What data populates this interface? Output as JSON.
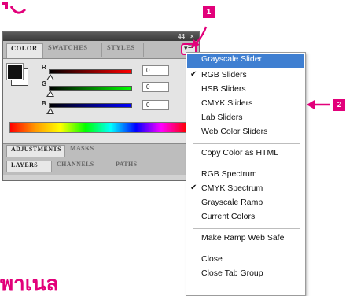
{
  "panel": {
    "tabs": [
      "COLOR",
      "SWATCHES",
      "STYLES"
    ],
    "title_controls": "44",
    "close_glyph": "×",
    "menu_icon": "panel-menu-icon",
    "channels": [
      {
        "label": "R",
        "value": "0",
        "gradient": [
          "#000000",
          "#ff0000"
        ]
      },
      {
        "label": "G",
        "value": "0",
        "gradient": [
          "#000000",
          "#00ff00"
        ]
      },
      {
        "label": "B",
        "value": "0",
        "gradient": [
          "#000000",
          "#0000ff"
        ]
      }
    ],
    "adjustments_tabs": [
      "ADJUSTMENTS",
      "MASKS"
    ],
    "layers_tabs": [
      "LAYERS",
      "CHANNELS",
      "PATHS"
    ]
  },
  "menu": {
    "items": [
      {
        "label": "Grayscale Slider",
        "checked": false,
        "highlighted": true
      },
      {
        "label": "RGB Sliders",
        "checked": true,
        "highlighted": false
      },
      {
        "label": "HSB Sliders",
        "checked": false,
        "highlighted": false
      },
      {
        "label": "CMYK Sliders",
        "checked": false,
        "highlighted": false
      },
      {
        "label": "Lab Sliders",
        "checked": false,
        "highlighted": false
      },
      {
        "label": "Web Color Sliders",
        "checked": false,
        "highlighted": false
      },
      {
        "label": "Copy Color as HTML",
        "checked": false,
        "highlighted": false
      },
      {
        "label": "RGB Spectrum",
        "checked": false,
        "highlighted": false
      },
      {
        "label": "CMYK Spectrum",
        "checked": true,
        "highlighted": false
      },
      {
        "label": "Grayscale Ramp",
        "checked": false,
        "highlighted": false
      },
      {
        "label": "Current Colors",
        "checked": false,
        "highlighted": false
      },
      {
        "label": "Make Ramp Web Safe",
        "checked": false,
        "highlighted": false
      },
      {
        "label": "Close",
        "checked": false,
        "highlighted": false
      },
      {
        "label": "Close Tab Group",
        "checked": false,
        "highlighted": false
      }
    ],
    "check_glyph": "✔"
  },
  "callouts": {
    "badge1": "1",
    "badge2": "2",
    "color": "#e2007a"
  },
  "thai_heading": "พาเนล",
  "colors": {
    "menu_highlight": "#3f7fd1",
    "accent": "#e2007a"
  }
}
